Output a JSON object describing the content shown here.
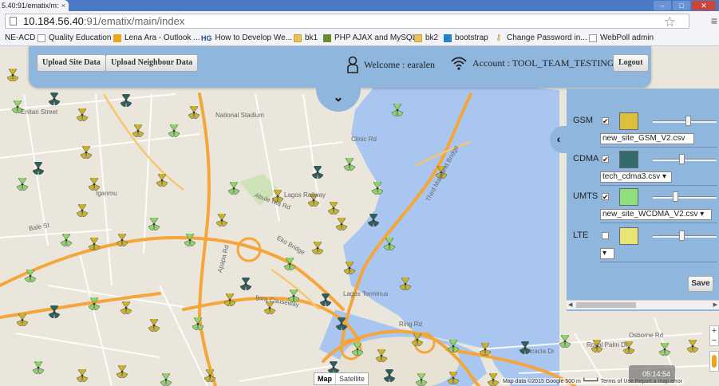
{
  "browser": {
    "tab_title": "5.40:91/ematix/m:",
    "tab_close": "×",
    "url_host": "10.184.56.40",
    "url_path": ":91/ematix/main/index",
    "star_icon": "star-icon",
    "menu_icon": "menu-icon",
    "bookmarks": [
      {
        "label": "NE-ACD",
        "icon": ""
      },
      {
        "label": "Quality Education",
        "icon": "page"
      },
      {
        "label": "Lena Ara - Outlook ...",
        "icon": "outlook"
      },
      {
        "label": "How to Develop We...",
        "icon": "hg"
      },
      {
        "label": "bk1",
        "icon": "folder"
      },
      {
        "label": "PHP AJAX and MySQL",
        "icon": "php"
      },
      {
        "label": "bk2",
        "icon": "folder"
      },
      {
        "label": "bootstrap",
        "icon": "boot"
      },
      {
        "label": "Change Password in...",
        "icon": "key"
      },
      {
        "label": "WebPoll admin",
        "icon": "page"
      }
    ]
  },
  "header": {
    "upload_site": "Upload Site Data",
    "upload_neighbour": "Upload Neighbour Data",
    "welcome": "Welcome : earalen",
    "account": "Account : TOOL_TEAM_TESTING",
    "logout": "Logout",
    "collapse_glyph": "⌄"
  },
  "layers": {
    "toggle_glyph": "‹",
    "items": [
      {
        "name": "GSM",
        "checked": true,
        "color": "#dcbf3c",
        "file": "new_site_GSM_V2.csv",
        "has_dropdown": false,
        "opacity": 0.55
      },
      {
        "name": "CDMA",
        "checked": true,
        "color": "#356b6b",
        "file": "tech_cdma3.csv",
        "has_dropdown": true,
        "opacity": 0.45
      },
      {
        "name": "UMTS",
        "checked": true,
        "color": "#8fe07a",
        "file": "new_site_WCDMA_V2.csv",
        "has_dropdown": true,
        "opacity": 0.35
      },
      {
        "name": "LTE",
        "checked": false,
        "color": "#e8e574",
        "file": "",
        "has_dropdown": true,
        "opacity": 0.45
      }
    ],
    "save": "Save"
  },
  "map": {
    "labels": [
      "National Stadium",
      "Clinic Rd",
      "Lagos Railway",
      "Iganmu",
      "Third Mainland Bridge",
      "Eko Bridge",
      "Apapa Rd",
      "Ijora Causeway",
      "Lagos Terminus",
      "Ring Rd",
      "Acacia Dr",
      "Royal Palm Dr",
      "Osborne Rd",
      "Bale St",
      "Enitan Street",
      "Abule Nla Rd"
    ],
    "map_type": "Map",
    "satellite": "Satellite",
    "attribution": "Map data ©2015 Google   500 m ┗━━━┛   Terms of Use   Report a map error",
    "zoom_in": "+",
    "zoom_out": "−",
    "clock": "05:14:54"
  }
}
